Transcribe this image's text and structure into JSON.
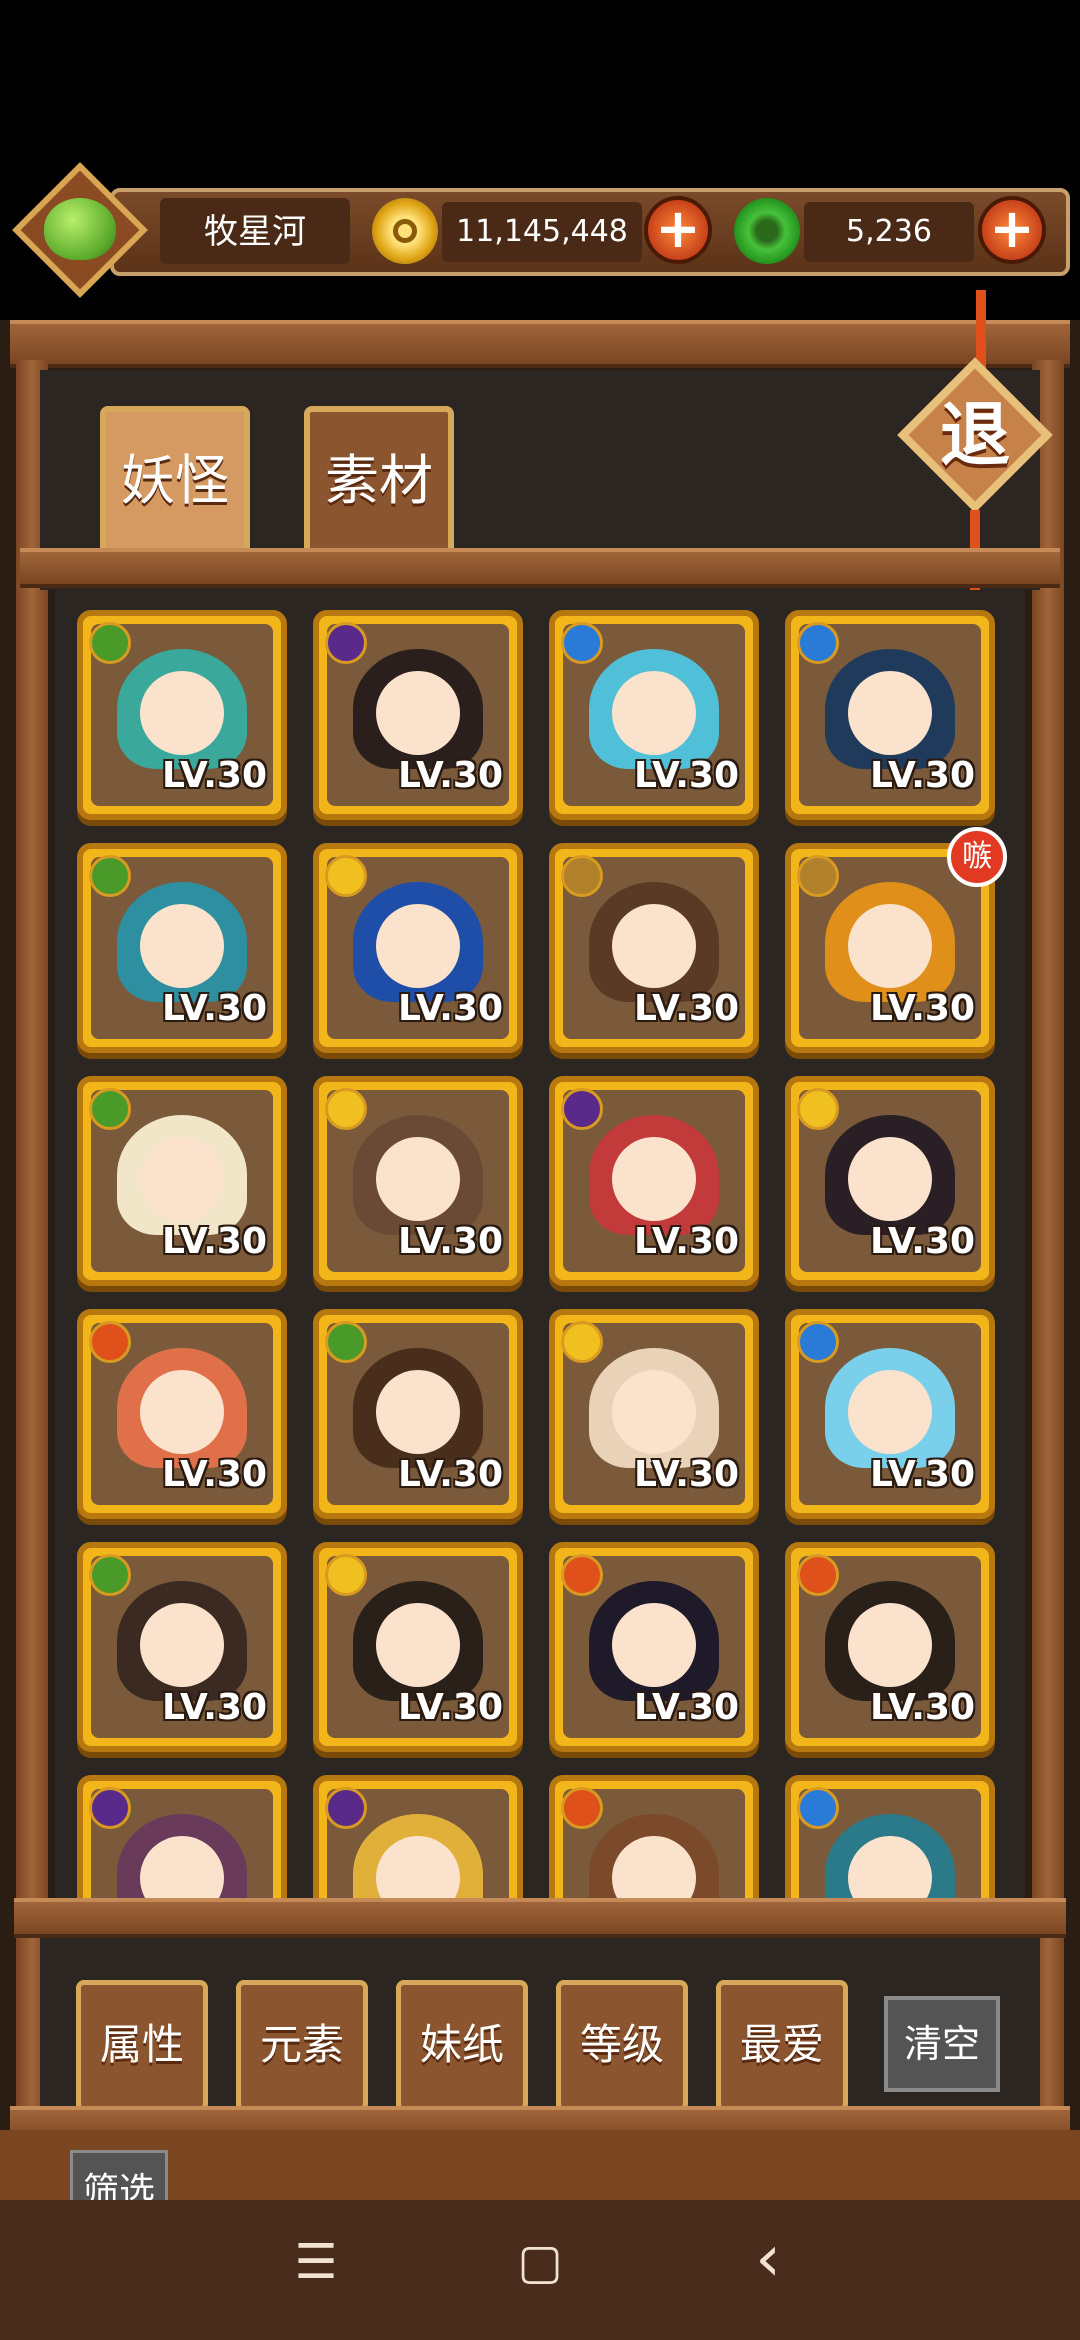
{
  "top_bar": {
    "player_name": "牧星河",
    "gold_amount": "11,145,448",
    "jade_amount": "5,236",
    "add_gold_label": "+",
    "add_jade_label": "+"
  },
  "tabs": [
    {
      "label": "妖怪",
      "active": true
    },
    {
      "label": "素材",
      "active": false
    }
  ],
  "exit_label": "退",
  "cards": [
    {
      "level": "LV.30",
      "element": "leaf",
      "hair": "#3aa89a"
    },
    {
      "level": "LV.30",
      "element": "moon",
      "hair": "#2a1f1c"
    },
    {
      "level": "LV.30",
      "element": "water",
      "hair": "#4fc0d8"
    },
    {
      "level": "LV.30",
      "element": "water",
      "hair": "#1f3a5a"
    },
    {
      "level": "LV.30",
      "element": "leaf",
      "hair": "#2e8fa0"
    },
    {
      "level": "LV.30",
      "element": "sun",
      "hair": "#1f4ea8"
    },
    {
      "level": "LV.30",
      "element": "earth",
      "hair": "#5a3a24"
    },
    {
      "level": "LV.30",
      "element": "earth",
      "hair": "#e0901a",
      "badge": "嗾"
    },
    {
      "level": "LV.30",
      "element": "leaf",
      "hair": "#f2e6c8"
    },
    {
      "level": "LV.30",
      "element": "sun",
      "hair": "#6a4a34"
    },
    {
      "level": "LV.30",
      "element": "moon",
      "hair": "#c23a3a"
    },
    {
      "level": "LV.30",
      "element": "sun",
      "hair": "#2a1f24"
    },
    {
      "level": "LV.30",
      "element": "fire",
      "hair": "#e0704a"
    },
    {
      "level": "LV.30",
      "element": "leaf",
      "hair": "#4a2e1c"
    },
    {
      "level": "LV.30",
      "element": "sun",
      "hair": "#e8d2b8"
    },
    {
      "level": "LV.30",
      "element": "water",
      "hair": "#7ad0ea"
    },
    {
      "level": "LV.30",
      "element": "leaf",
      "hair": "#3a2a22"
    },
    {
      "level": "LV.30",
      "element": "sun",
      "hair": "#2a201a"
    },
    {
      "level": "LV.30",
      "element": "fire",
      "hair": "#1f1a2a"
    },
    {
      "level": "LV.30",
      "element": "fire",
      "hair": "#2a201a"
    },
    {
      "level": "",
      "element": "moon",
      "hair": "#6a3a5a"
    },
    {
      "level": "",
      "element": "moon",
      "hair": "#e0b03a"
    },
    {
      "level": "",
      "element": "fire",
      "hair": "#7a4a2a"
    },
    {
      "level": "",
      "element": "water",
      "hair": "#2a7a8a"
    }
  ],
  "element_colors": {
    "leaf": "#4a9a2a",
    "moon": "#5a2a8a",
    "water": "#2a7ad8",
    "sun": "#f0c020",
    "earth": "#b0802a",
    "fire": "#e0501a"
  },
  "filters": [
    {
      "label": "属性"
    },
    {
      "label": "元素"
    },
    {
      "label": "妹纸"
    },
    {
      "label": "等级"
    },
    {
      "label": "最爱"
    }
  ],
  "clear_label": "清空",
  "screen_label": "筛选",
  "nav": {
    "menu_icon": "☰",
    "home_icon": "▢",
    "back_icon": "‹"
  }
}
